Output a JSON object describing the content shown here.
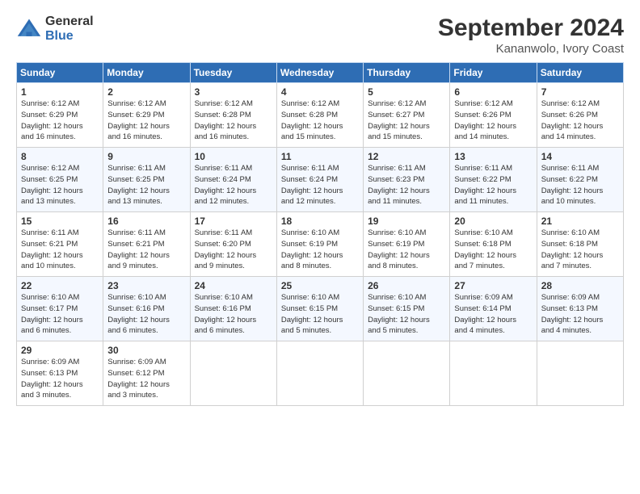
{
  "logo": {
    "general": "General",
    "blue": "Blue"
  },
  "header": {
    "month": "September 2024",
    "location": "Kananwolo, Ivory Coast"
  },
  "weekdays": [
    "Sunday",
    "Monday",
    "Tuesday",
    "Wednesday",
    "Thursday",
    "Friday",
    "Saturday"
  ],
  "weeks": [
    [
      {
        "day": "1",
        "info": "Sunrise: 6:12 AM\nSunset: 6:29 PM\nDaylight: 12 hours\nand 16 minutes."
      },
      {
        "day": "2",
        "info": "Sunrise: 6:12 AM\nSunset: 6:29 PM\nDaylight: 12 hours\nand 16 minutes."
      },
      {
        "day": "3",
        "info": "Sunrise: 6:12 AM\nSunset: 6:28 PM\nDaylight: 12 hours\nand 16 minutes."
      },
      {
        "day": "4",
        "info": "Sunrise: 6:12 AM\nSunset: 6:28 PM\nDaylight: 12 hours\nand 15 minutes."
      },
      {
        "day": "5",
        "info": "Sunrise: 6:12 AM\nSunset: 6:27 PM\nDaylight: 12 hours\nand 15 minutes."
      },
      {
        "day": "6",
        "info": "Sunrise: 6:12 AM\nSunset: 6:26 PM\nDaylight: 12 hours\nand 14 minutes."
      },
      {
        "day": "7",
        "info": "Sunrise: 6:12 AM\nSunset: 6:26 PM\nDaylight: 12 hours\nand 14 minutes."
      }
    ],
    [
      {
        "day": "8",
        "info": "Sunrise: 6:12 AM\nSunset: 6:25 PM\nDaylight: 12 hours\nand 13 minutes."
      },
      {
        "day": "9",
        "info": "Sunrise: 6:11 AM\nSunset: 6:25 PM\nDaylight: 12 hours\nand 13 minutes."
      },
      {
        "day": "10",
        "info": "Sunrise: 6:11 AM\nSunset: 6:24 PM\nDaylight: 12 hours\nand 12 minutes."
      },
      {
        "day": "11",
        "info": "Sunrise: 6:11 AM\nSunset: 6:24 PM\nDaylight: 12 hours\nand 12 minutes."
      },
      {
        "day": "12",
        "info": "Sunrise: 6:11 AM\nSunset: 6:23 PM\nDaylight: 12 hours\nand 11 minutes."
      },
      {
        "day": "13",
        "info": "Sunrise: 6:11 AM\nSunset: 6:22 PM\nDaylight: 12 hours\nand 11 minutes."
      },
      {
        "day": "14",
        "info": "Sunrise: 6:11 AM\nSunset: 6:22 PM\nDaylight: 12 hours\nand 10 minutes."
      }
    ],
    [
      {
        "day": "15",
        "info": "Sunrise: 6:11 AM\nSunset: 6:21 PM\nDaylight: 12 hours\nand 10 minutes."
      },
      {
        "day": "16",
        "info": "Sunrise: 6:11 AM\nSunset: 6:21 PM\nDaylight: 12 hours\nand 9 minutes."
      },
      {
        "day": "17",
        "info": "Sunrise: 6:11 AM\nSunset: 6:20 PM\nDaylight: 12 hours\nand 9 minutes."
      },
      {
        "day": "18",
        "info": "Sunrise: 6:10 AM\nSunset: 6:19 PM\nDaylight: 12 hours\nand 8 minutes."
      },
      {
        "day": "19",
        "info": "Sunrise: 6:10 AM\nSunset: 6:19 PM\nDaylight: 12 hours\nand 8 minutes."
      },
      {
        "day": "20",
        "info": "Sunrise: 6:10 AM\nSunset: 6:18 PM\nDaylight: 12 hours\nand 7 minutes."
      },
      {
        "day": "21",
        "info": "Sunrise: 6:10 AM\nSunset: 6:18 PM\nDaylight: 12 hours\nand 7 minutes."
      }
    ],
    [
      {
        "day": "22",
        "info": "Sunrise: 6:10 AM\nSunset: 6:17 PM\nDaylight: 12 hours\nand 6 minutes."
      },
      {
        "day": "23",
        "info": "Sunrise: 6:10 AM\nSunset: 6:16 PM\nDaylight: 12 hours\nand 6 minutes."
      },
      {
        "day": "24",
        "info": "Sunrise: 6:10 AM\nSunset: 6:16 PM\nDaylight: 12 hours\nand 6 minutes."
      },
      {
        "day": "25",
        "info": "Sunrise: 6:10 AM\nSunset: 6:15 PM\nDaylight: 12 hours\nand 5 minutes."
      },
      {
        "day": "26",
        "info": "Sunrise: 6:10 AM\nSunset: 6:15 PM\nDaylight: 12 hours\nand 5 minutes."
      },
      {
        "day": "27",
        "info": "Sunrise: 6:09 AM\nSunset: 6:14 PM\nDaylight: 12 hours\nand 4 minutes."
      },
      {
        "day": "28",
        "info": "Sunrise: 6:09 AM\nSunset: 6:13 PM\nDaylight: 12 hours\nand 4 minutes."
      }
    ],
    [
      {
        "day": "29",
        "info": "Sunrise: 6:09 AM\nSunset: 6:13 PM\nDaylight: 12 hours\nand 3 minutes."
      },
      {
        "day": "30",
        "info": "Sunrise: 6:09 AM\nSunset: 6:12 PM\nDaylight: 12 hours\nand 3 minutes."
      },
      null,
      null,
      null,
      null,
      null
    ]
  ]
}
